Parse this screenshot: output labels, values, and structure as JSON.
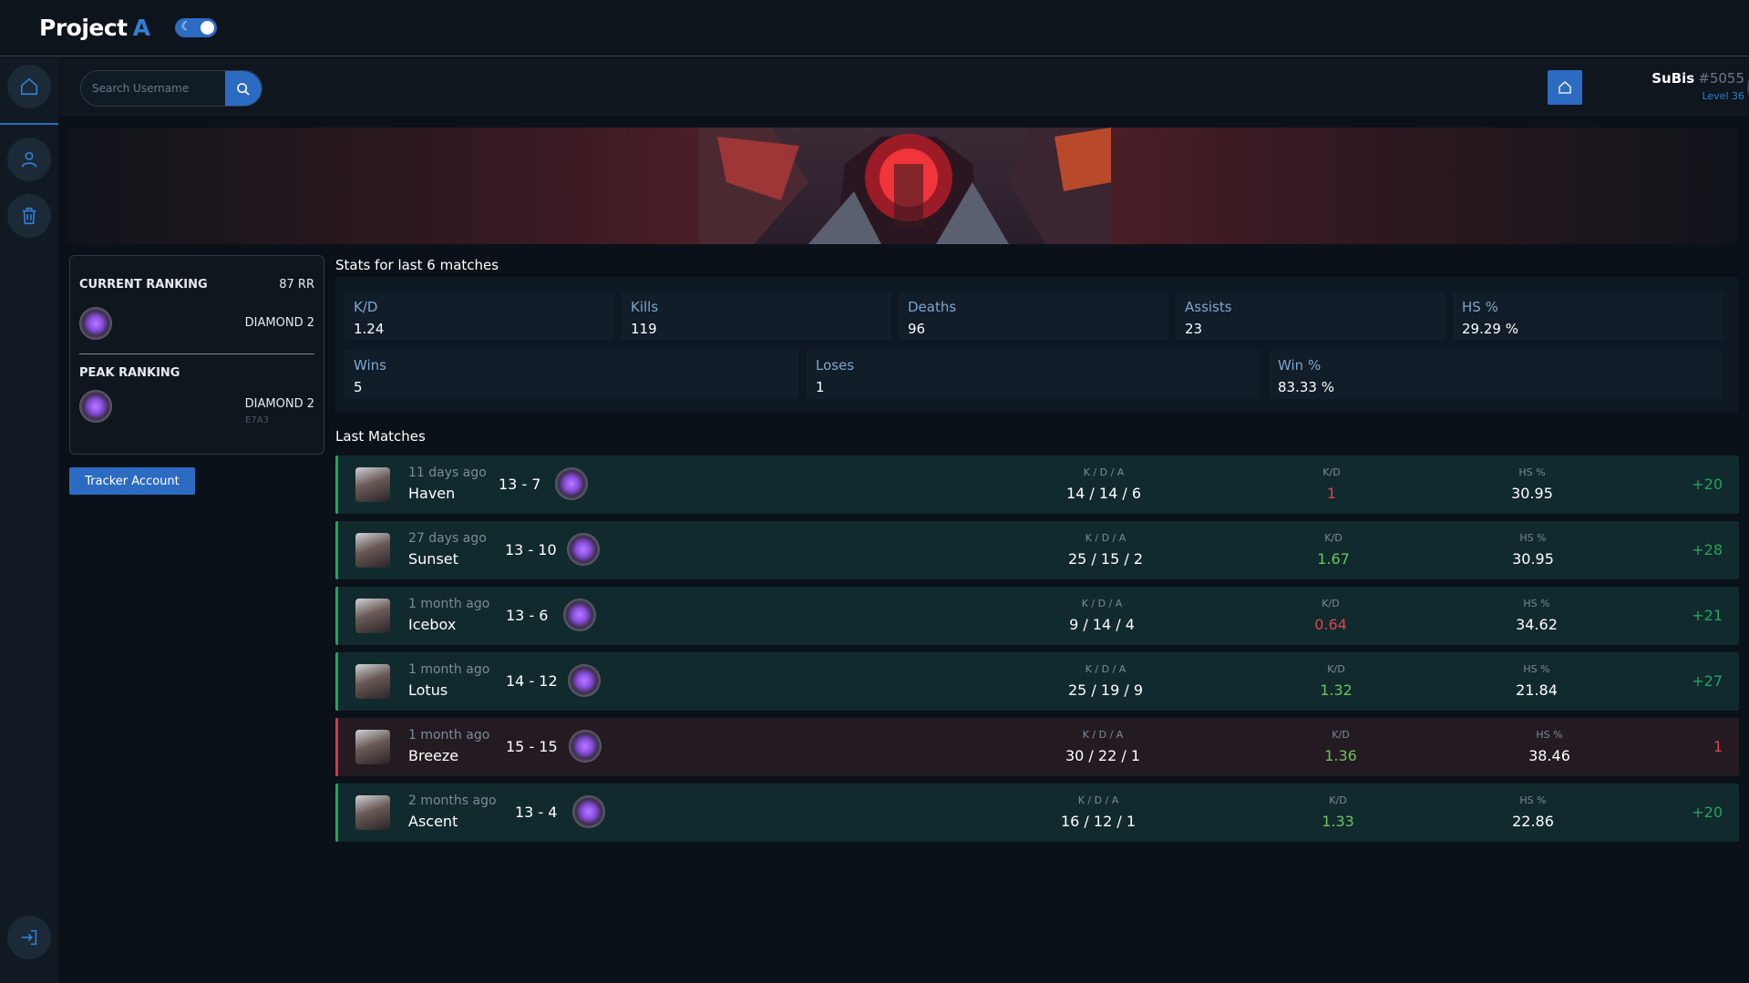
{
  "app": {
    "title": "Project",
    "title_accent": "A",
    "toggle_icon": "moon-icon"
  },
  "search": {
    "placeholder": "Search Username"
  },
  "user": {
    "name": "SuBis",
    "tag": "#5055",
    "level": "Level 36"
  },
  "ranking": {
    "current_title": "CURRENT RANKING",
    "current_rr": "87 RR",
    "current_rank": "DIAMOND 2",
    "peak_title": "PEAK RANKING",
    "peak_rank": "DIAMOND 2",
    "peak_act": "E7A3"
  },
  "tracker_button": "Tracker Account",
  "stats": {
    "title": "Stats for last 6 matches",
    "row1": [
      {
        "label": "K/D",
        "value": "1.24"
      },
      {
        "label": "Kills",
        "value": "119"
      },
      {
        "label": "Deaths",
        "value": "96"
      },
      {
        "label": "Assists",
        "value": "23"
      },
      {
        "label": "HS %",
        "value": "29.29 %"
      }
    ],
    "row2": [
      {
        "label": "Wins",
        "value": "5"
      },
      {
        "label": "Loses",
        "value": "1"
      },
      {
        "label": "Win %",
        "value": "83.33 %"
      }
    ]
  },
  "matches_title": "Last Matches",
  "match_labels": {
    "kda": "K / D / A",
    "kd": "K/D",
    "hs": "HS %"
  },
  "matches": [
    {
      "time": "11 days ago",
      "map": "Haven",
      "score": "13 - 7",
      "kda": "14 / 14 / 6",
      "kd": "1",
      "hs": "30.95",
      "rr": "+20",
      "result": "win"
    },
    {
      "time": "27 days ago",
      "map": "Sunset",
      "score": "13 - 10",
      "kda": "25 / 15 / 2",
      "kd": "1.67",
      "hs": "30.95",
      "rr": "+28",
      "result": "win"
    },
    {
      "time": "1 month ago",
      "map": "Icebox",
      "score": "13 - 6",
      "kda": "9 / 14 / 4",
      "kd": "0.64",
      "hs": "34.62",
      "rr": "+21",
      "result": "win"
    },
    {
      "time": "1 month ago",
      "map": "Lotus",
      "score": "14 - 12",
      "kda": "25 / 19 / 9",
      "kd": "1.32",
      "hs": "21.84",
      "rr": "+27",
      "result": "win"
    },
    {
      "time": "1 month ago",
      "map": "Breeze",
      "score": "15 - 15",
      "kda": "30 / 22 / 1",
      "kd": "1.36",
      "hs": "38.46",
      "rr": "1",
      "result": "loss"
    },
    {
      "time": "2 months ago",
      "map": "Ascent",
      "score": "13 - 4",
      "kda": "16 / 12 / 1",
      "kd": "1.33",
      "hs": "22.86",
      "rr": "+20",
      "result": "win"
    }
  ],
  "colors": {
    "accent": "#2c6bc2",
    "win": "#27a35a",
    "loss": "#d2384a",
    "kd_good": "#6cc35a",
    "kd_bad": "#e0434f"
  }
}
